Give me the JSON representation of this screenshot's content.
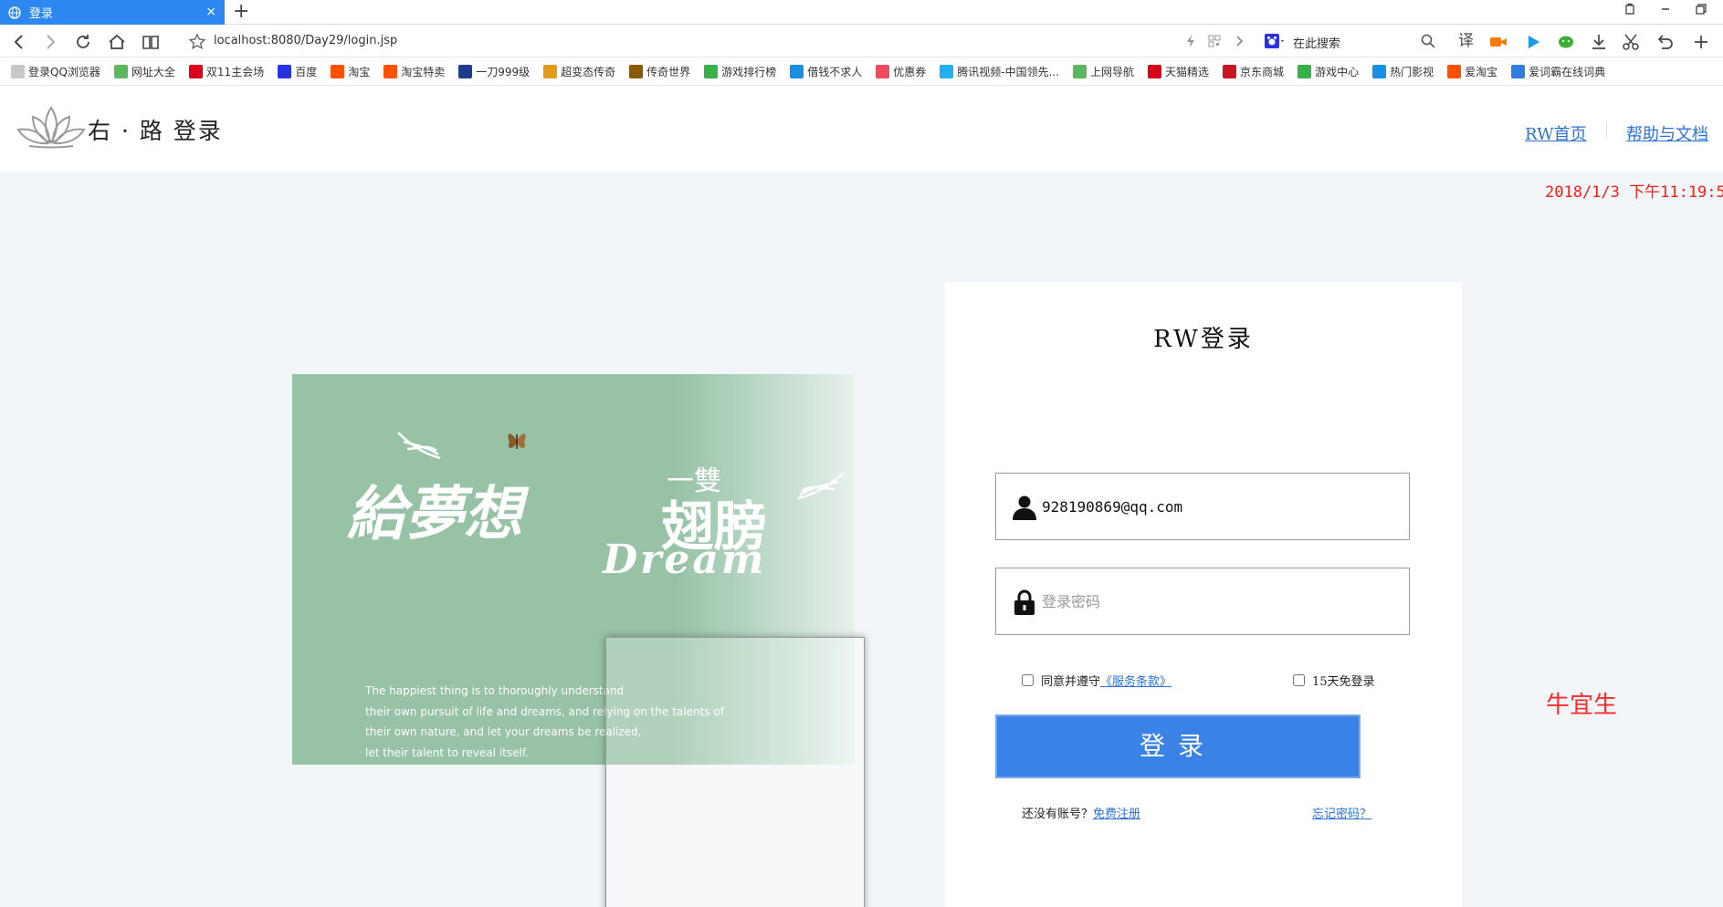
{
  "browser": {
    "tab_title": "登录",
    "tab_close": "×",
    "new_tab": "+",
    "url": "localhost:8080/Day29/login.jsp",
    "search_placeholder": "在此搜索",
    "window_controls": [
      "restore-icon",
      "minimize-icon",
      "maximize-icon"
    ],
    "toolbar_icons": [
      "translate-icon",
      "video-record-icon",
      "play-icon",
      "wechat-icon",
      "download-icon",
      "scissors-icon",
      "undo-icon",
      "add-icon"
    ],
    "translate_label": "译",
    "bookmarks": [
      {
        "label": "登录QQ浏览器",
        "icon": "qq-user-icon",
        "color": "#c8c8c8"
      },
      {
        "label": "网址大全",
        "icon": "hao123-icon",
        "color": "#5cb85c"
      },
      {
        "label": "双11主会场",
        "icon": "tmall-icon",
        "color": "#d9001b"
      },
      {
        "label": "百度",
        "icon": "baidu-icon",
        "color": "#2932e1"
      },
      {
        "label": "淘宝",
        "icon": "taobao-icon",
        "color": "#ff5000"
      },
      {
        "label": "淘宝特卖",
        "icon": "taobao-icon",
        "color": "#ff5000"
      },
      {
        "label": "一刀999级",
        "icon": "game-icon",
        "color": "#1f3a8a"
      },
      {
        "label": "超变态传奇",
        "icon": "game-icon",
        "color": "#e39b1b"
      },
      {
        "label": "传奇世界",
        "icon": "game-icon",
        "color": "#8a5a00"
      },
      {
        "label": "游戏排行榜",
        "icon": "gamepad-icon",
        "color": "#36b14a"
      },
      {
        "label": "借钱不求人",
        "icon": "loan-icon",
        "color": "#1a8fe3"
      },
      {
        "label": "优惠券",
        "icon": "coupon-icon",
        "color": "#f04a5c"
      },
      {
        "label": "腾讯视频-中国领先...",
        "icon": "tencent-video-icon",
        "color": "#20b0f0"
      },
      {
        "label": "上网导航",
        "icon": "hao123-icon",
        "color": "#5cb85c"
      },
      {
        "label": "天猫精选",
        "icon": "tmall-icon",
        "color": "#d9001b"
      },
      {
        "label": "京东商城",
        "icon": "jd-icon",
        "color": "#c91623"
      },
      {
        "label": "游戏中心",
        "icon": "gamepad-icon",
        "color": "#36b14a"
      },
      {
        "label": "热门影视",
        "icon": "play-icon",
        "color": "#1a8fe3"
      },
      {
        "label": "爱淘宝",
        "icon": "taobao-icon",
        "color": "#ff5000"
      },
      {
        "label": "爱词霸在线词典",
        "icon": "iciba-icon",
        "color": "#2f7de1"
      }
    ]
  },
  "header": {
    "site_name": "右 · 路 登录",
    "nav": [
      "RW首页",
      "帮助与文档"
    ],
    "clock": "2018/1/3 下午11:19:5"
  },
  "banner": {
    "title_main": "給夢想",
    "title_small": "一雙",
    "title_wings": "翅膀",
    "title_en": "Dream",
    "quote_lines": [
      "The happiest thing is to thoroughly understand",
      "their own pursuit of life and dreams, and relying on the talents of",
      "their own nature, and let your dreams be realized,",
      "let their talent to reveal itself."
    ]
  },
  "login": {
    "title": "RW登录",
    "username_value": "928190869@qq.com",
    "password_placeholder": "登录密码",
    "agree_prefix": "同意并遵守",
    "agree_link": "《服务条款》",
    "remember_label": "15天免登录",
    "submit_label": "登录",
    "no_account_prefix": "还没有账号？",
    "register_link": "免费注册",
    "forgot_link": "忘记密码？"
  },
  "author": "牛宜生",
  "colors": {
    "tab_active": "#2c87f0",
    "link": "#2b72d6",
    "primary_button": "#3b82e6",
    "banner_green": "#97c2a6",
    "clock_red": "#ff1a1a"
  }
}
